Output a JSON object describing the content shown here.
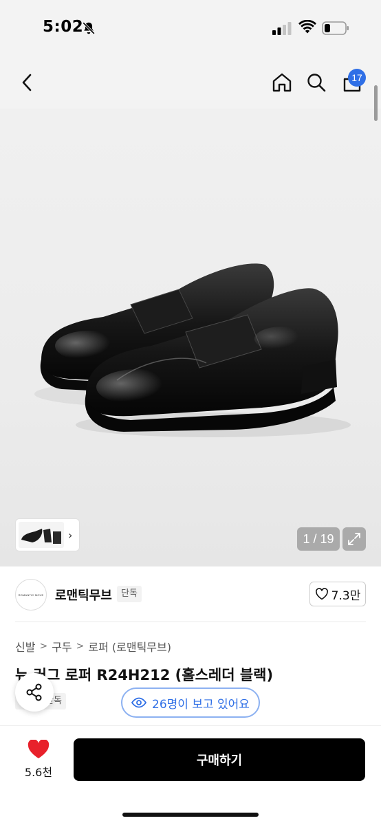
{
  "status_bar": {
    "time": "5:02",
    "icons": [
      "bell-slash-icon",
      "signal-icon",
      "wifi-icon",
      "battery-icon"
    ]
  },
  "nav": {
    "icons": [
      "chevron-left-icon",
      "home-icon",
      "search-icon",
      "cart-icon"
    ],
    "cart_badge": "17"
  },
  "gallery": {
    "counter": "1 / 19",
    "thumbnail_arrow": "›",
    "expand_icon": "expand-icon"
  },
  "brand": {
    "logo_text": "ROMANTIC MOVE",
    "name": "로맨틱무브",
    "tag": "단독",
    "like_count": "7.3만"
  },
  "product": {
    "breadcrumb": [
      "신발",
      "구두",
      "로퍼 (로맨틱무브)"
    ],
    "breadcrumb_separator": ">",
    "title": "뉴 러그 로퍼 R24H212 (홀스레더 블랙)",
    "tag": "단독",
    "viewers": "26명이 보고 있어요"
  },
  "bottom_bar": {
    "wish_count": "5.6천",
    "buy_label": "구매하기"
  },
  "colors": {
    "accent_blue": "#2f6fe6",
    "heart_red": "#e8212b",
    "buy_button_bg": "#000000"
  }
}
